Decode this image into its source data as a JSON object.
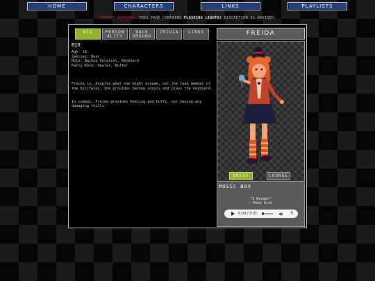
{
  "nav": [
    "HOME",
    "CHARACTERS",
    "LINKS",
    "PLAYLISTS"
  ],
  "warning": {
    "label": "CONTENT WARNING:",
    "pre": " THIS PAGE CONTAINS ",
    "highlight": "FLASHING LIGHTS!",
    "post": " DISCRETION IS ADVISED."
  },
  "tabs": [
    "BIO",
    "PERSON ALITY",
    "BACK GROUND",
    "TRIVIA",
    "LINKS"
  ],
  "bio": {
    "title": "BIO",
    "info": [
      "Age: 18",
      "Species: Bear",
      "Role: Backup Vocalist, Keyboard",
      "Party Role: Healer, Buffer"
    ],
    "paragraphs": [
      "Freida is, despite what one might assume, not the lead member of the Dollfaces. She provides backup vocals and plays the keyboard.",
      "In combat, Freida provides healing and buffs, not having any damaging skills."
    ]
  },
  "character": {
    "name": "FREIDA",
    "buttons": [
      "DRESS",
      "LOUNGE"
    ]
  },
  "music": {
    "title": "MUSIC BOX",
    "song": "\"I Wonder\"",
    "artist": "- Mike Krol",
    "time": "0:00 / 3:21"
  },
  "colors": {
    "nav": "#26417a",
    "active": "#92b02a",
    "warning": "#d42b2b",
    "panel": "#5a5a5a"
  }
}
